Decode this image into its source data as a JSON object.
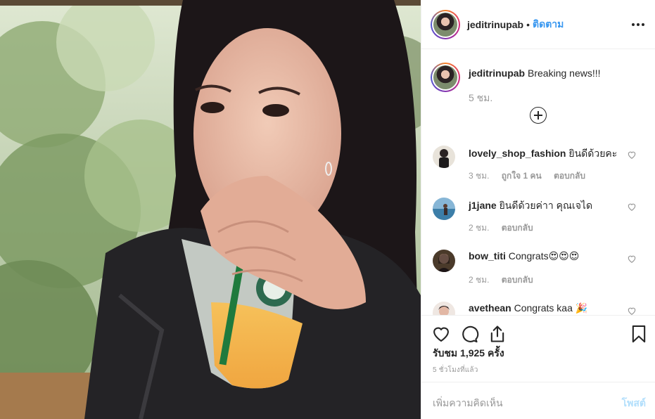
{
  "header": {
    "username": "jeditrinupab",
    "separator": "•",
    "follow_label": "ติดตาม"
  },
  "caption": {
    "username": "jeditrinupab",
    "text": "Breaking news!!!",
    "time": "5 ชม."
  },
  "comments": [
    {
      "username": "lovely_shop_fashion",
      "text": "ยินดีด้วยคะ",
      "time": "3 ชม.",
      "likes": "ถูกใจ 1 คน",
      "reply": "ตอบกลับ"
    },
    {
      "username": "j1jane",
      "text": "ยินดีด้วยค่าา คุณเจได",
      "time": "2 ชม.",
      "reply": "ตอบกลับ"
    },
    {
      "username": "bow_titi",
      "text": "Congrats😍😍😍",
      "time": "2 ชม.",
      "reply": "ตอบกลับ"
    },
    {
      "username": "avethean",
      "text": "Congrats kaa 🎉"
    }
  ],
  "stats": {
    "views": "รับชม 1,925 ครั้ง",
    "posted": "5 ชั่วโมงที่แล้ว"
  },
  "add_comment": {
    "placeholder": "เพิ่มความคิดเห็น",
    "post_label": "โพสต์"
  },
  "icons": {
    "more": "more-horizontal-icon",
    "load_more": "plus-circle-icon",
    "like": "heart-icon",
    "comment": "comment-bubble-icon",
    "share": "share-icon",
    "save": "bookmark-icon"
  },
  "colors": {
    "link": "#3897f0",
    "muted": "#999999",
    "post_disabled": "#b2dffc"
  }
}
